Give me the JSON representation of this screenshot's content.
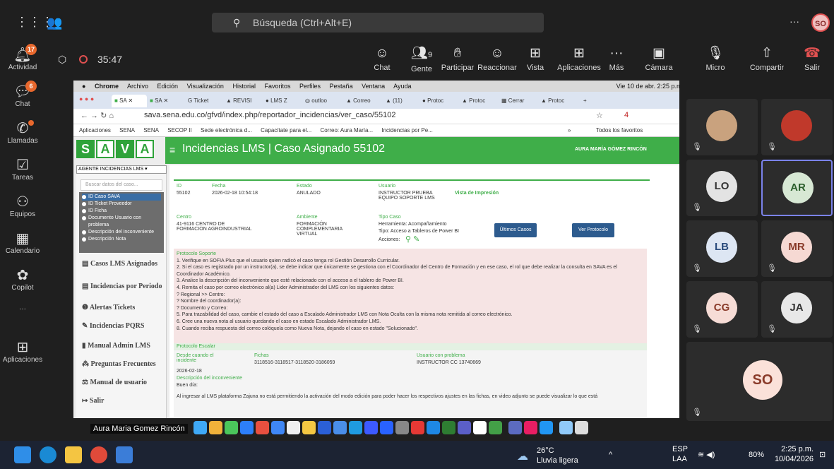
{
  "teams": {
    "search_placeholder": "Búsqueda (Ctrl+Alt+E)",
    "user_initials": "SO",
    "more": "···"
  },
  "rail": [
    {
      "label": "Actividad",
      "badge": "17"
    },
    {
      "label": "Chat",
      "badge": "6"
    },
    {
      "label": "Llamadas"
    },
    {
      "label": "Tareas"
    },
    {
      "label": "Equipos"
    },
    {
      "label": "Calendario"
    },
    {
      "label": "Copilot"
    },
    {
      "label": "···"
    },
    {
      "label": "Aplicaciones"
    }
  ],
  "meeting": {
    "timer": "35:47",
    "buttons": {
      "chat": "Chat",
      "people": "Gente",
      "people_count": "9",
      "raise": "Participar",
      "react": "Reaccionar",
      "view": "Vista",
      "apps": "Aplicaciones",
      "more": "Más",
      "camera": "Cámara",
      "mic": "Micro",
      "share": "Compartir",
      "leave": "Salir"
    }
  },
  "mac_menu": {
    "items": [
      "Chrome",
      "Archivo",
      "Edición",
      "Visualización",
      "Historial",
      "Favoritos",
      "Perfiles",
      "Pestaña",
      "Ventana",
      "Ayuda"
    ],
    "clock": "Vie 10 de abr. 2:25 p.m."
  },
  "chrome": {
    "tabs": [
      "SA",
      "SA",
      "Ticket",
      "REVISI",
      "LMS Z",
      "outloo",
      "Correo",
      "(11)",
      "Protoc",
      "Protoc",
      "Cerrar",
      "Protoc"
    ],
    "url": "sava.sena.edu.co/gfvd/index.php/reportador_incidencias/ver_caso/55102",
    "bookmarks": [
      "Aplicaciones",
      "SENA",
      "SENA",
      "SECOP II",
      "Sede electrónica d...",
      "Capacítate para el...",
      "Correo: Aura María...",
      "Incidencias por Pe...",
      "»",
      "Todos los favoritos"
    ],
    "ext_badge": "4"
  },
  "sava": {
    "logo_letters": [
      "S",
      "A",
      "V",
      "A"
    ],
    "header_title": "Incidencias LMS | Caso Asignado 55102",
    "header_user": "AURA MARÍA GÓMEZ RINCÓN",
    "role_select": "AGENTE INCIDENCIAS LMS",
    "search_placeholder": "Buscar datos del caso...",
    "search_options": [
      {
        "label": "ID Caso SAVA",
        "selected": true
      },
      {
        "label": "ID Ticket Proveedor"
      },
      {
        "label": "ID Ficha"
      },
      {
        "label": "Documento Usuario con problema"
      },
      {
        "label": "Descripción del inconveniente"
      },
      {
        "label": "Descripción Nota"
      }
    ],
    "nav": [
      "Casos LMS Asignados",
      "Incidencias por Periodo",
      "Alertas Tickets",
      "Incidencias PQRS",
      "Manual Admin LMS",
      "Preguntas Frecuentes",
      "Manual de usuario",
      "Salir"
    ],
    "case": {
      "id_label": "ID",
      "id": "55102",
      "fecha_label": "Fecha",
      "fecha": "2026-02-18 10:54:18",
      "estado_label": "Estado",
      "estado": "ANULADO",
      "usuario_label": "Usuario",
      "usuario": "INSTRUCTOR PRUEBA EQUIPO SOPORTE LMS",
      "print": "Vista de Impresión",
      "centro_label": "Centro",
      "centro": "41-9116 CENTRO DE FORMACION AGROINDUSTRIAL",
      "ambiente_label": "Ambiente",
      "ambiente": "FORMACIÓN COMPLEMENTARIA VIRTUAL",
      "tipo_label": "Tipo Caso",
      "herramienta": "Herramienta: Acompañamiento",
      "tipo": "Tipo: Acceso a Tableros de Power BI",
      "acciones": "Acciones:",
      "btn_ultimos": "Últimos Casos",
      "btn_protocolo": "Ver Protocolo"
    },
    "protocol_title": "Protocolo Soporte",
    "protocol_lines": [
      "1. Verifique en SOFIA Plus que el usuario quien radicó el caso tenga rol Gestión Desarrollo Curricular.",
      "2. Si el caso es registrado por un instructor(a), se debe indicar que únicamente se gestiona con el Coordinador del Centro de Formación y en ese caso, el rol que debe realizar la consulta en SAVA es el",
      "Coordinador Académico.",
      "3. Analice la descripción del inconveniente que esté relacionado con el acceso a el tablero de Power BI.",
      "4. Remita el caso por correo electrónico al(a) Lider Administrador del LMS con los siguientes datos:",
      "? Regional >> Centro:",
      "? Nombre del coordinador(a):",
      "? Documento y Correo:",
      "5. Para trazabilidad del caso, cambie el estado del caso a Escalado Administrador LMS con Nota Oculta con la misma nota remitida al correo electrónico.",
      "6. Cree una nueva nota al usuario quedando el caso en estado Escalado Administrador LMS.",
      "8. Cuando reciba respuesta del correo colóquela como Nueva Nota, dejando el caso en estado \"Solucionado\"."
    ],
    "escalar_label": "Protocolo Escalar",
    "desde_label": "Desde cuando el incidente",
    "desde": "2026-02-18",
    "fichas_label": "Fichas",
    "fichas": "3118516-3118517-3118520-3186059",
    "usuario_problema_label": "Usuario con problema",
    "usuario_problema": "INSTRUCTOR CC 13740669",
    "desc_label": "Descripción del inconveniente",
    "desc_1": "Buen día:",
    "desc_2": "Al ingresar al LMS plataforma Zajuna no está permitiendo la activación del modo edición para poder hacer los respectivos ajustes en las fichas, en video adjunto se puede visualizar lo que está"
  },
  "presenter_name": "Aura Maria Gomez Rincón",
  "participants": [
    {
      "initials": "",
      "photo": true
    },
    {
      "initials": "",
      "photo": true
    },
    {
      "initials": "LO"
    },
    {
      "initials": "AR",
      "active": true
    },
    {
      "initials": "LB"
    },
    {
      "initials": "MR"
    },
    {
      "initials": "CG"
    },
    {
      "initials": "JA"
    },
    {
      "initials": "SO"
    }
  ],
  "taskbar": {
    "temp": "26°C",
    "weather": "Lluvia ligera",
    "lang1": "ESP",
    "lang2": "LAA",
    "battery": "80%",
    "time": "2:25 p.m.",
    "date": "10/04/2026"
  },
  "colors": {
    "sena_green": "#3fae49",
    "teams_purple": "#7b83eb",
    "leave_red": "#e05050"
  }
}
